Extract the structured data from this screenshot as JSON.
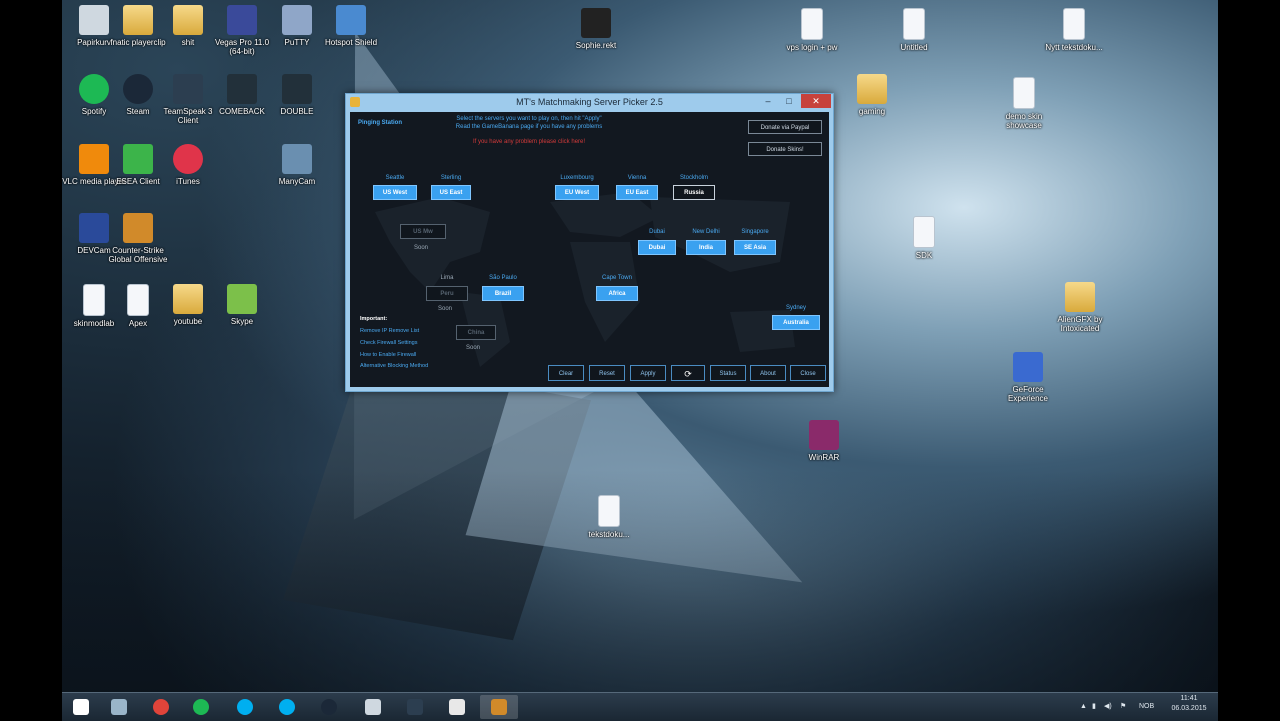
{
  "desktop_icons": [
    {
      "label": "Papirkurv",
      "icon": "recycle-bin-icon",
      "color": "#cfd8e0"
    },
    {
      "label": "fnatic playerclip",
      "icon": "folder-icon",
      "color": "#e8c46a"
    },
    {
      "label": "shit",
      "icon": "folder-icon",
      "color": "#e8c46a"
    },
    {
      "label": "Vegas Pro 11.0 (64-bit)",
      "icon": "vegas-icon",
      "color": "#3a4a9a"
    },
    {
      "label": "PuTTY",
      "icon": "putty-icon",
      "color": "#8fa6c8"
    },
    {
      "label": "Hotspot Shield",
      "icon": "shield-icon",
      "color": "#4a8ad0"
    },
    {
      "label": "Sophie.rekt",
      "icon": "file-icon",
      "color": "#222"
    },
    {
      "label": "vps login + pw",
      "icon": "document-icon",
      "color": "#f5f7fa"
    },
    {
      "label": "Untitled",
      "icon": "document-icon",
      "color": "#f5f7fa"
    },
    {
      "label": "Nytt tekstdoku...",
      "icon": "document-icon",
      "color": "#f5f7fa"
    },
    {
      "label": "Spotify",
      "icon": "spotify-icon",
      "color": "#1db954"
    },
    {
      "label": "Steam",
      "icon": "steam-icon",
      "color": "#1b2838"
    },
    {
      "label": "TeamSpeak 3 Client",
      "icon": "teamspeak-icon",
      "color": "#2c3e50"
    },
    {
      "label": "COMEBACK",
      "icon": "app-icon",
      "color": "#22303a"
    },
    {
      "label": "DOUBLE",
      "icon": "app-icon",
      "color": "#22303a"
    },
    {
      "label": "gaming",
      "icon": "folder-icon",
      "color": "#e8c46a"
    },
    {
      "label": "demo skin showcase",
      "icon": "document-icon",
      "color": "#f5f7fa"
    },
    {
      "label": "VLC media player",
      "icon": "vlc-icon",
      "color": "#f08a0c"
    },
    {
      "label": "ESEA Client",
      "icon": "esea-icon",
      "color": "#3cb44a"
    },
    {
      "label": "iTunes",
      "icon": "itunes-icon",
      "color": "#e0344a"
    },
    {
      "label": "ManyCam",
      "icon": "manycam-icon",
      "color": "#6a8fb0"
    },
    {
      "label": "DEVCam",
      "icon": "devcam-icon",
      "color": "#2a4a9a"
    },
    {
      "label": "Counter-Strike Global Offensive",
      "icon": "csgo-icon",
      "color": "#d18a2a"
    },
    {
      "label": "SDK",
      "icon": "document-icon",
      "color": "#f5f7fa"
    },
    {
      "label": "skinmodlab",
      "icon": "document-icon",
      "color": "#f5f7fa"
    },
    {
      "label": "Apex",
      "icon": "document-icon",
      "color": "#f5f7fa"
    },
    {
      "label": "youtube",
      "icon": "folder-icon",
      "color": "#e8c46a"
    },
    {
      "label": "Skype",
      "icon": "android-icon",
      "color": "#7cc04a"
    },
    {
      "label": "AlienGFX by Intoxicated",
      "icon": "folder-icon",
      "color": "#e8c46a"
    },
    {
      "label": "GeForce Experience",
      "icon": "computer-icon",
      "color": "#3a6ad0"
    },
    {
      "label": "tekstdoku...",
      "icon": "document-icon",
      "color": "#f5f7fa"
    },
    {
      "label": "WinRAR",
      "icon": "winrar-icon",
      "color": "#8a2a6a"
    }
  ],
  "window": {
    "title": "MT's Matchmaking Server Picker 2.5",
    "minimize": "–",
    "maximize": "□",
    "close": "✕",
    "ping_status": "Pinging Station",
    "instructions_line1": "Select the servers you want to play on, then hit \"Apply\"",
    "instructions_line2": "Read the GameBanana page if you have any problems",
    "warning": "If you have any problem please click here!",
    "donate_paypal": "Donate via Paypal",
    "donate_skins": "Donate Skins!",
    "locations": {
      "seattle": "Seattle",
      "sterling": "Sterling",
      "luxembourg": "Luxembourg",
      "vienna": "Vienna",
      "stockholm": "Stockholm",
      "dubai": "Dubai",
      "new_delhi": "New Delhi",
      "singapore": "Singapore",
      "lima": "Lima",
      "sao_paulo": "São Paulo",
      "cape_town": "Cape Town",
      "sydney": "Sydney"
    },
    "servers": {
      "us_west": "US West",
      "us_east": "US East",
      "eu_west": "EU West",
      "eu_east": "EU East",
      "russia": "Russia",
      "us_mw": "US Mw",
      "dubai": "Dubai",
      "india": "India",
      "se_asia": "SE Asia",
      "peru": "Peru",
      "brazil": "Brazil",
      "africa": "Africa",
      "china": "China",
      "australia": "Australia"
    },
    "soon": "Soon",
    "important": {
      "heading": "Important:",
      "items": [
        "Remove IP Remove List",
        "Check Firewall Settings",
        "How to Enable Firewall",
        "Alternative Blocking Method"
      ]
    },
    "buttons": {
      "clear": "Clear",
      "reset": "Reset",
      "apply": "Apply",
      "refresh": "⟳",
      "status": "Status",
      "about": "About",
      "close": "Close"
    }
  },
  "taskbar": {
    "items": [
      {
        "icon": "windows-start-icon",
        "color": "#ffffff"
      },
      {
        "icon": "notepad-icon",
        "color": "#9ab5c9"
      },
      {
        "icon": "chrome-icon",
        "color": "#e0443a"
      },
      {
        "icon": "spotify-icon",
        "color": "#1db954"
      },
      {
        "icon": "skype-icon",
        "color": "#00aff0"
      },
      {
        "icon": "skype-icon",
        "color": "#00aff0"
      },
      {
        "icon": "steam-icon",
        "color": "#1b2838"
      },
      {
        "icon": "file-explorer-icon",
        "color": "#cfd8e0"
      },
      {
        "icon": "teamspeak-icon",
        "color": "#2c3e50"
      },
      {
        "icon": "camtasia-icon",
        "color": "#e8e8e8"
      },
      {
        "icon": "csgo-icon",
        "color": "#d18a2a"
      }
    ],
    "tray_lang": "NOB",
    "time": "11:41",
    "date": "06.03.2015"
  }
}
